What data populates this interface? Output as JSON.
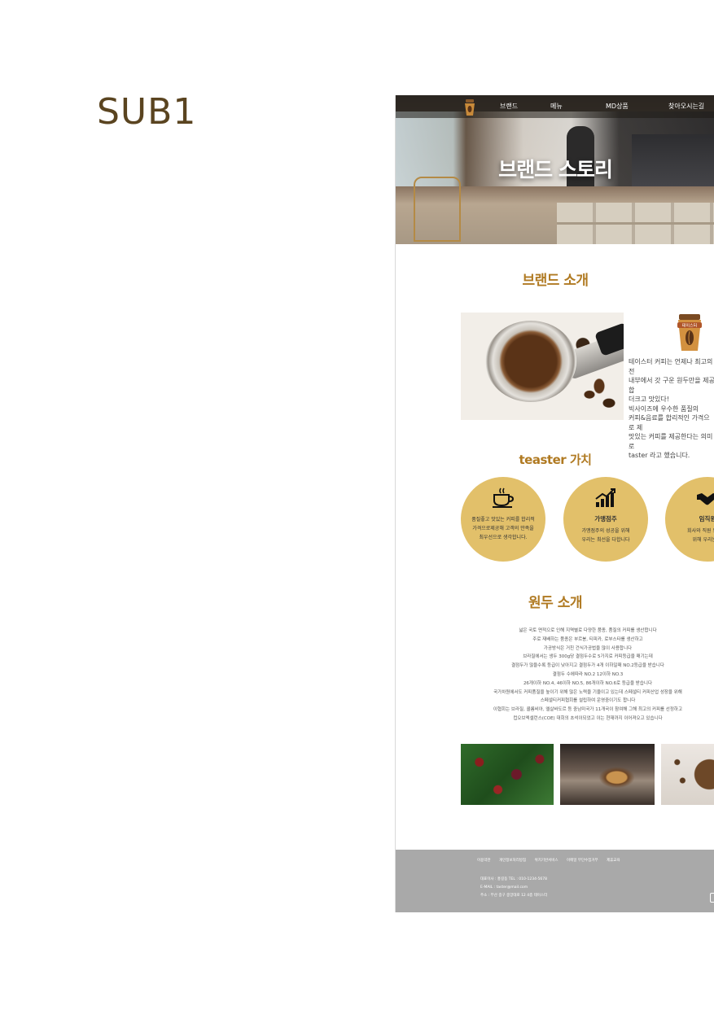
{
  "page_label": "SUB1",
  "mockup": {
    "nav": {
      "items": [
        "브랜드",
        "메뉴",
        "MD상품",
        "찾아오시는길"
      ]
    },
    "hero": {
      "title": "브랜드 스토리"
    },
    "brand_intro": {
      "title": "브랜드 소개",
      "badge_text": "테이스터",
      "text": "테이스터 커피는 언제나 최고의 전\n내부에서 갓 구운 원두만을 제공합\n더크고 맛있다!\n빅사이즈에 우수한 품질의\n커피&음료를 합리적인 가격으로 제\n맛있는 커피를 제공한다는 의미로\ntaster 라고 했습니다."
    },
    "values": {
      "title": "teaster 가치",
      "items": [
        {
          "icon": "coffee-cup-icon",
          "title": "",
          "lines": [
            "품질좋고 맛있는 커피를 합리적",
            "가격으로제공해 고객의 만족을",
            "최우선으로 생각합니다."
          ]
        },
        {
          "icon": "growth-chart-icon",
          "title": "가맹점주",
          "lines": [
            "가맹점주의 성공을 위해",
            "우리는 최선을 다합니다"
          ]
        },
        {
          "icon": "handshake-icon",
          "title": "임직원",
          "lines": [
            "회사와 직원 모두 함",
            "위해 우리는 노"
          ]
        }
      ]
    },
    "beans": {
      "title": "원두 소개",
      "lines": [
        "넓은 국토 면적으로 인해 지역별로 다양한 품종, 품질의 커피를 생산합니다",
        "주로 재배하는 품종은 부르봉, 티피카, 로부스타를 생산하고",
        "가공방식은 거친 건식가공법을 많이 사용합니다",
        "브라질에서는 생두 300g당 결점두수로 5가지로 커피등급을 매기는데",
        "결점두가 많을수록 등급이 낮아지고 결점두가 4개 이하일때 NO.2등급을 받습니다",
        "결점두 수에따라 NO.2 12이하 NO.3",
        "26개이하 NO.4, 46이하 NO.5, 86개이하 NO.6로 등급을 받습니다",
        "국가차원에서도 커피품질을 높이기 위해 많은 노력을 기울이고 있는데 스페셜티 커피산업 성장을 위해",
        "스페셜티커피협회를 설립하여 운영중이기도 합니다",
        "이협회는 브라질, 콜롬비아, 엘살바도르 등 중남미국가 11개국이 참여해 그해 최고의 커피를 선정하고",
        "컵오브엑셀런스(COE) 대회의 초석이되었고 이는 현재까지 이어져오고 있습니다"
      ]
    },
    "footer": {
      "links": [
        "이용약관",
        "개인정보처리방침",
        "위치기반서비스",
        "이메일 무단수집거부",
        "제휴교육"
      ],
      "info": [
        "대표이사 : 홍길동  TEL : 010-1234-5678",
        "E-MAIL : taster@mail.com",
        "주소 : 부산 중구 중앙대로 12 4층 테이스터"
      ]
    }
  },
  "colors": {
    "accent": "#b07a22",
    "circle": "#e2c06a",
    "footer": "#a9a9a9",
    "label": "#5a4420"
  }
}
